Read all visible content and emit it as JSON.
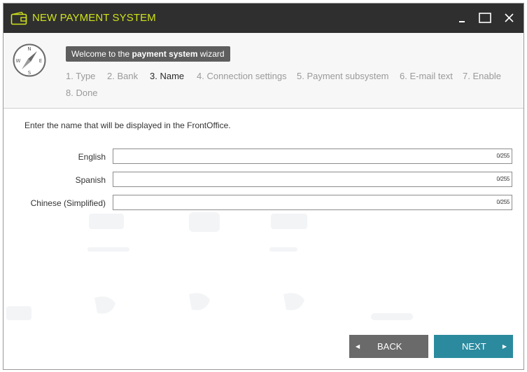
{
  "window": {
    "title": "NEW PAYMENT SYSTEM"
  },
  "welcome": {
    "prefix": "Welcome to the ",
    "bold": "payment system",
    "suffix": " wizard"
  },
  "steps": [
    {
      "label": "1. Type"
    },
    {
      "label": "2. Bank"
    },
    {
      "label": "3. Name"
    },
    {
      "label": "4. Connection settings"
    },
    {
      "label": "5. Payment subsystem"
    },
    {
      "label": "6. E-mail text"
    },
    {
      "label": "7. Enable"
    },
    {
      "label": "8. Done"
    }
  ],
  "active_step": "3. Name",
  "compass_letters": {
    "n": "N",
    "s": "S",
    "e": "E",
    "w": "W"
  },
  "form": {
    "instruction": "Enter the name that will be displayed in the FrontOffice.",
    "fields": [
      {
        "label": "English",
        "value": "",
        "counter": "0/255"
      },
      {
        "label": "Spanish",
        "value": "",
        "counter": "0/255"
      },
      {
        "label": "Chinese (Simplified)",
        "value": "",
        "counter": "0/255"
      }
    ]
  },
  "buttons": {
    "back": "BACK",
    "next": "NEXT",
    "back_arrow": "◀",
    "next_arrow": "▶"
  },
  "colors": {
    "title_bar": "#2f2f2f",
    "title_text": "#cfe21a",
    "next_button": "#2b8a9e",
    "back_button": "#6a6a6a",
    "welcome_tag": "#5e5e5e"
  }
}
